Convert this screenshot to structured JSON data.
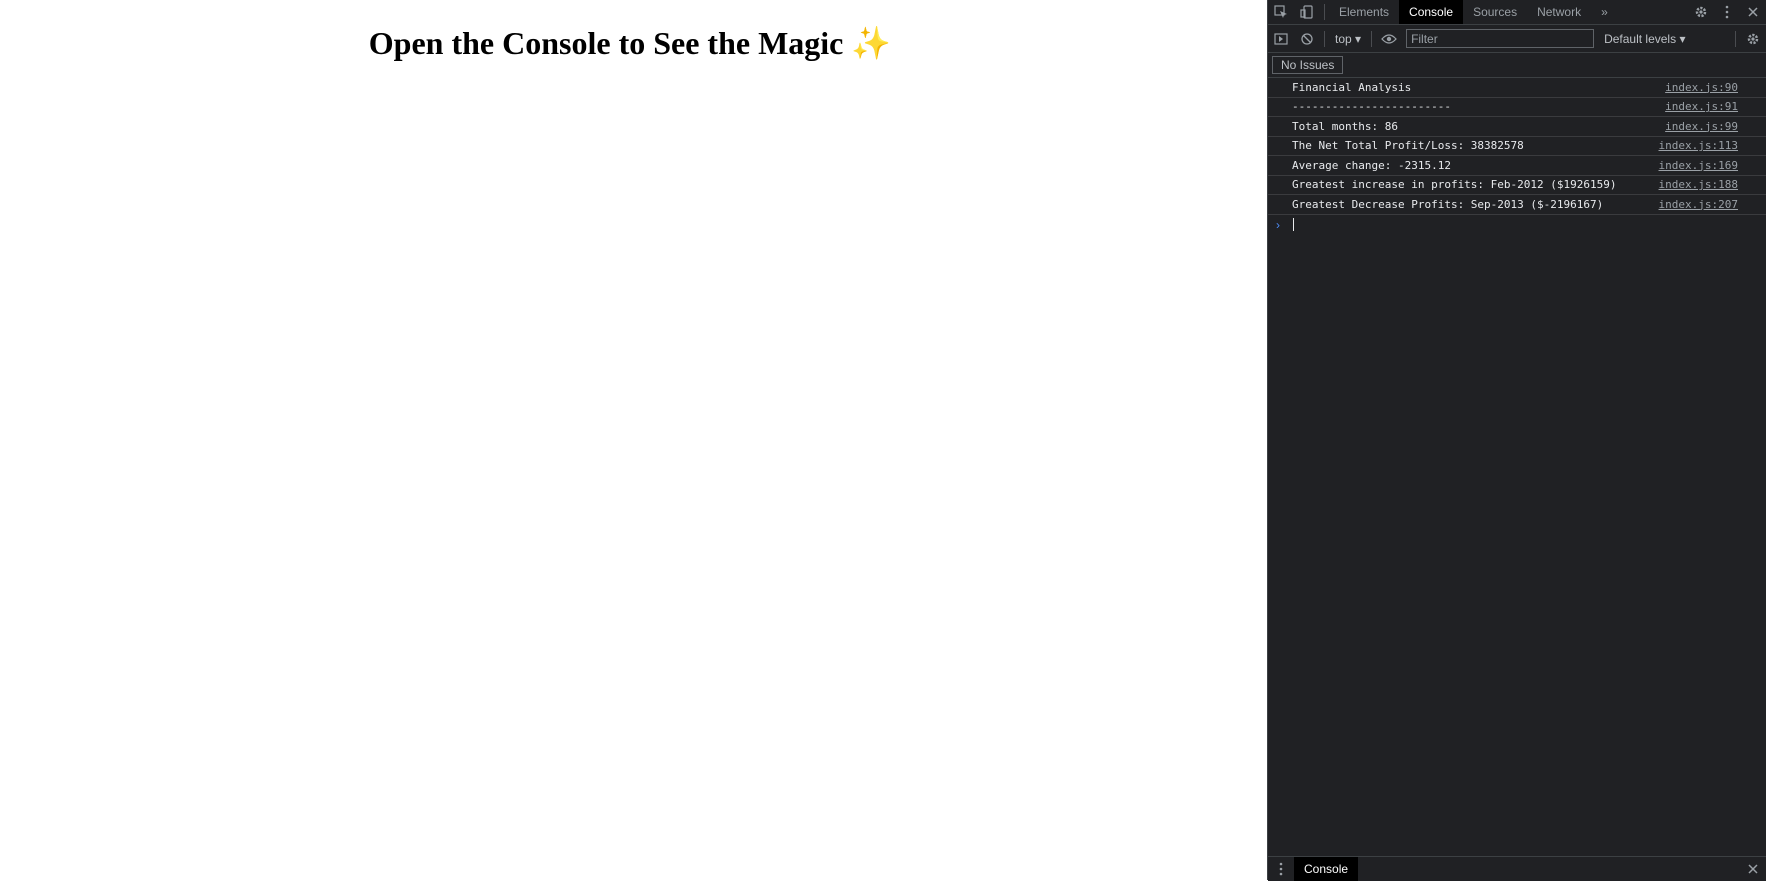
{
  "page": {
    "heading": "Open the Console to See the Magic",
    "heading_emoji": "✨"
  },
  "devtools": {
    "tabs": [
      "Elements",
      "Console",
      "Sources",
      "Network"
    ],
    "active_tab": "Console",
    "more_tabs_icon": "»",
    "context": "top",
    "filter_placeholder": "Filter",
    "levels": "Default levels",
    "issues": "No Issues",
    "messages": [
      {
        "text": "Financial Analysis",
        "source": "index.js:90"
      },
      {
        "text": "------------------------",
        "source": "index.js:91"
      },
      {
        "text": "Total months: 86",
        "source": "index.js:99"
      },
      {
        "text": "The Net Total Profit/Loss: 38382578",
        "source": "index.js:113"
      },
      {
        "text": "Average change: -2315.12",
        "source": "index.js:169"
      },
      {
        "text": "Greatest increase in profits: Feb-2012 ($1926159)",
        "source": "index.js:188"
      },
      {
        "text": "Greatest Decrease Profits: Sep-2013 ($-2196167)",
        "source": "index.js:207"
      }
    ],
    "drawer_tab": "Console"
  },
  "colors": {
    "devtools_bg": "#202124",
    "active_tab_bg": "#000000",
    "prompt_arrow": "#4e8cf5"
  }
}
